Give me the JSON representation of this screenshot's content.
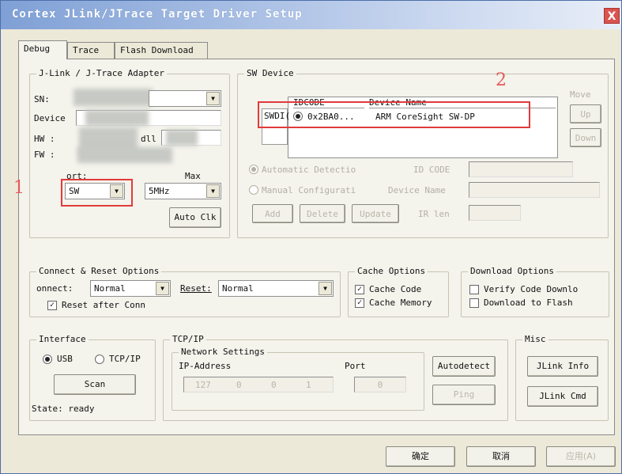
{
  "window": {
    "title": "Cortex JLink/JTrace Target Driver Setup",
    "close_label": "X"
  },
  "tabs": [
    {
      "label": "Debug"
    },
    {
      "label": "Trace"
    },
    {
      "label": "Flash Download"
    }
  ],
  "jlink": {
    "legend": "J-Link / J-Trace Adapter",
    "sn_label": "SN:",
    "device_label": "Device",
    "hw_label": "HW :",
    "dll_label": "dll",
    "fw_label": "FW :",
    "port_label": "ort:",
    "port_value": "SW",
    "max_label": "Max",
    "max_value": "5MHz",
    "auto_clk": "Auto Clk"
  },
  "sw_device": {
    "legend": "SW Device",
    "col_idcode": "IDCODE",
    "col_device_name": "Device Name",
    "row_label": "SWDI(",
    "row_idcode": "0x2BA0...",
    "row_device": "ARM CoreSight SW-DP",
    "move_label": "Move",
    "up_label": "Up",
    "down_label": "Down",
    "auto_detect": "Automatic Detectio",
    "manual_config": "Manual Configurati",
    "id_code_label": "ID CODE",
    "device_name_label": "Device Name",
    "ir_len_label": "IR len",
    "add": "Add",
    "delete": "Delete",
    "update": "Update"
  },
  "annotations": {
    "one": "1",
    "two": "2"
  },
  "connect": {
    "legend": "Connect & Reset Options",
    "connect_label": "onnect:",
    "connect_value": "Normal",
    "reset_label": "Reset:",
    "reset_value": "Normal",
    "reset_after_conn": "Reset after Conn"
  },
  "cache": {
    "legend": "Cache Options",
    "cache_code": "Cache Code",
    "cache_memory": "Cache Memory"
  },
  "download": {
    "legend": "Download Options",
    "verify": "Verify Code Downlo",
    "download_flash": "Download to Flash"
  },
  "interface": {
    "legend": "Interface",
    "usb": "USB",
    "tcpip": "TCP/IP",
    "scan": "Scan",
    "state": "State: ready"
  },
  "tcpip": {
    "legend": "TCP/IP",
    "network_legend": "Network Settings",
    "ip_label": "IP-Address",
    "port_label": "Port",
    "ip": [
      "127",
      "0",
      "0",
      "1"
    ],
    "port_value": "0",
    "autodetect": "Autodetect",
    "ping": "Ping"
  },
  "misc": {
    "legend": "Misc",
    "jlink_info": "JLink Info",
    "jlink_cmd": "JLink Cmd"
  },
  "footer": {
    "ok": "确定",
    "cancel": "取消",
    "apply": "应用(A)"
  }
}
